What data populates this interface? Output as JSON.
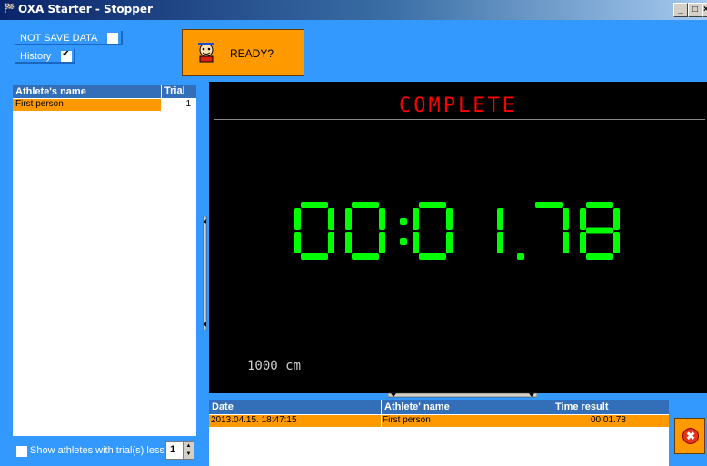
{
  "window": {
    "title": "OXA Starter - Stopper",
    "minimize": "_",
    "maximize": "□",
    "close": "×"
  },
  "options": {
    "not_save_data": {
      "label": "NOT SAVE DATA",
      "checked": false
    },
    "history": {
      "label": "History",
      "checked": true
    }
  },
  "ready_button": {
    "label": "READY?"
  },
  "athletes": {
    "columns": [
      "Athlete's name",
      "Trial"
    ],
    "rows": [
      {
        "name": "First person",
        "trial": "1"
      }
    ]
  },
  "filter": {
    "label": "Show athletes with trial(s) less than:",
    "checked": false,
    "value": "1"
  },
  "display": {
    "status": "COMPLETE",
    "time": "00:01.78",
    "distance": "1000 cm",
    "status_color": "#ff0000",
    "time_color": "#00ff00"
  },
  "results": {
    "columns": [
      "Date",
      "Athlete' name",
      "Time result"
    ],
    "rows": [
      {
        "date": "2013.04.15. 18:47:15",
        "athlete": "First person",
        "time": "00:01.78"
      }
    ]
  },
  "colors": {
    "background": "#3399ff",
    "accent": "#ff9900",
    "header": "#336fb8"
  }
}
